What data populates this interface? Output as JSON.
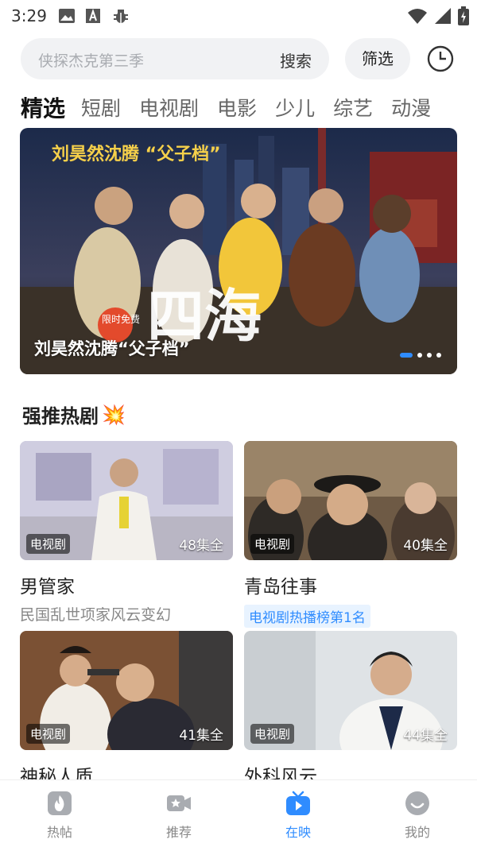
{
  "status_bar": {
    "time": "3:29"
  },
  "search": {
    "placeholder": "侠探杰克第三季",
    "button_label": "搜索"
  },
  "filter_label": "筛选",
  "tabs": [
    {
      "label": "精选",
      "active": true
    },
    {
      "label": "短剧"
    },
    {
      "label": "电视剧"
    },
    {
      "label": "电影"
    },
    {
      "label": "少儿"
    },
    {
      "label": "综艺"
    },
    {
      "label": "动漫"
    }
  ],
  "banner": {
    "caption": "刘昊然沈腾“父子档”",
    "poster_headline": "刘昊然沈腾 “父子档”",
    "poster_badge": "限时免费",
    "poster_title": "四海"
  },
  "section": {
    "title": "强推热剧",
    "emoji": "💥"
  },
  "cards": [
    {
      "tag": "电视剧",
      "count": "48集全",
      "title": "男管家",
      "subtitle": "民国乱世项家风云变幻"
    },
    {
      "tag": "电视剧",
      "count": "40集全",
      "title": "青岛往事",
      "badge": "电视剧热播榜第1名"
    },
    {
      "tag": "电视剧",
      "count": "41集全",
      "title": "神秘人质"
    },
    {
      "tag": "电视剧",
      "count": "44集全",
      "title": "外科风云"
    }
  ],
  "bottom_nav": [
    {
      "label": "热帖",
      "icon": "flame-icon"
    },
    {
      "label": "推荐",
      "icon": "video-camera-icon"
    },
    {
      "label": "在映",
      "icon": "tv-play-icon",
      "active": true
    },
    {
      "label": "我的",
      "icon": "smiley-face-icon"
    }
  ],
  "colors": {
    "accent": "#2f8cff",
    "search_bg": "#f1f2f4"
  }
}
